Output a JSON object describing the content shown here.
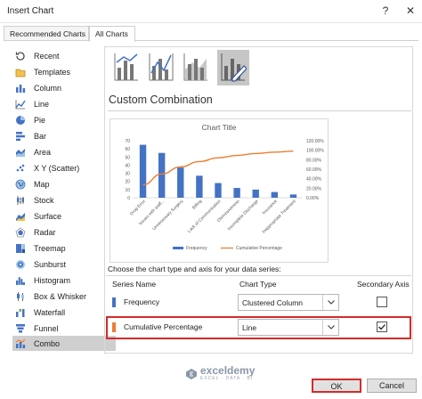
{
  "window": {
    "title": "Insert Chart",
    "help_glyph": "?",
    "close_glyph": "✕"
  },
  "tabs": [
    {
      "label": "Recommended Charts",
      "active": false
    },
    {
      "label": "All Charts",
      "active": true
    }
  ],
  "sidebar": {
    "items": [
      {
        "label": "Recent",
        "icon": "recent-icon"
      },
      {
        "label": "Templates",
        "icon": "templates-icon"
      },
      {
        "label": "Column",
        "icon": "column-chart-icon"
      },
      {
        "label": "Line",
        "icon": "line-chart-icon"
      },
      {
        "label": "Pie",
        "icon": "pie-chart-icon"
      },
      {
        "label": "Bar",
        "icon": "bar-chart-icon"
      },
      {
        "label": "Area",
        "icon": "area-chart-icon"
      },
      {
        "label": "X Y (Scatter)",
        "icon": "scatter-chart-icon"
      },
      {
        "label": "Map",
        "icon": "map-chart-icon"
      },
      {
        "label": "Stock",
        "icon": "stock-chart-icon"
      },
      {
        "label": "Surface",
        "icon": "surface-chart-icon"
      },
      {
        "label": "Radar",
        "icon": "radar-chart-icon"
      },
      {
        "label": "Treemap",
        "icon": "treemap-chart-icon"
      },
      {
        "label": "Sunburst",
        "icon": "sunburst-chart-icon"
      },
      {
        "label": "Histogram",
        "icon": "histogram-chart-icon"
      },
      {
        "label": "Box & Whisker",
        "icon": "box-whisker-chart-icon"
      },
      {
        "label": "Waterfall",
        "icon": "waterfall-chart-icon"
      },
      {
        "label": "Funnel",
        "icon": "funnel-chart-icon"
      },
      {
        "label": "Combo",
        "icon": "combo-chart-icon",
        "selected": true
      }
    ]
  },
  "main": {
    "section_title": "Custom Combination",
    "choose_label": "Choose the chart type and axis for your data series:",
    "table": {
      "headers": [
        "Series Name",
        "Chart Type",
        "Secondary Axis"
      ],
      "rows": [
        {
          "name": "Frequency",
          "type": "Clustered Column",
          "secondary": false,
          "color": "#4472c4"
        },
        {
          "name": "Cumulative Percentage",
          "type": "Line",
          "secondary": true,
          "color": "#ed7d31"
        }
      ]
    }
  },
  "chart_data": {
    "type": "bar",
    "title": "Chart Title",
    "categories": [
      "Drug Error",
      "Issues with staff...",
      "Unnecessary Surgery",
      "Billing",
      "Lack of Communication",
      "Dismissiveness",
      "Incomplete Discharge",
      "Insurance",
      "Inappropriate Treatment"
    ],
    "series": [
      {
        "name": "Frequency",
        "type": "bar",
        "axis": "primary",
        "color": "#4472c4",
        "values": [
          65,
          55,
          37,
          27,
          18,
          12,
          10,
          7,
          4
        ]
      },
      {
        "name": "Cumulative Percentage",
        "type": "line",
        "axis": "secondary",
        "color": "#ed7d31",
        "values": [
          0.27,
          0.5,
          0.65,
          0.76,
          0.84,
          0.89,
          0.93,
          0.96,
          0.98
        ]
      }
    ],
    "ylim": [
      0,
      70
    ],
    "yticks": [
      "0",
      "10",
      "20",
      "30",
      "40",
      "50",
      "60",
      "70"
    ],
    "y2lim": [
      0,
      1.2
    ],
    "y2ticks": [
      "0.00%",
      "20.00%",
      "40.00%",
      "60.00%",
      "80.00%",
      "100.00%",
      "120.00%"
    ],
    "legend": "bottom",
    "grid": false
  },
  "footer": {
    "ok_label": "OK",
    "cancel_label": "Cancel"
  },
  "watermark": {
    "name": "exceldemy",
    "tagline": "EXCEL · DATA · BI"
  },
  "colors": {
    "accent": "#4472c4",
    "secondary": "#ed7d31",
    "highlight": "#d32b2b",
    "selected_bg": "#cfcfcf"
  }
}
